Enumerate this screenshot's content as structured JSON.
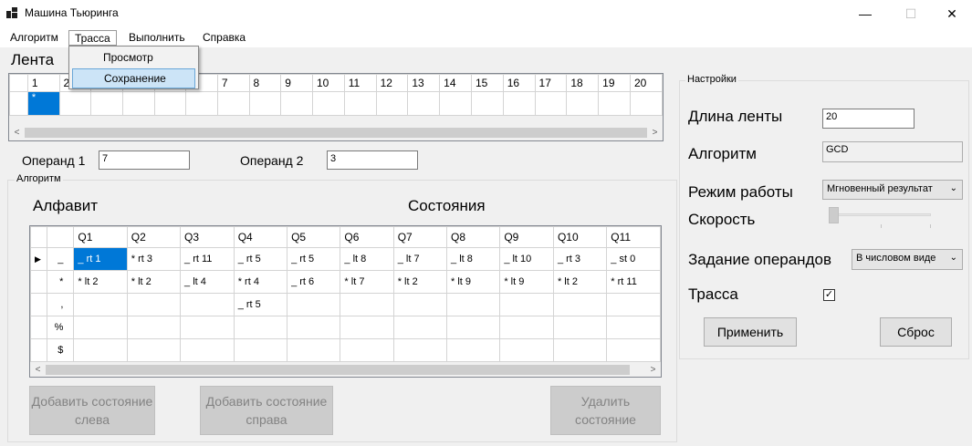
{
  "window": {
    "title": "Машина Тьюринга",
    "minimize": "—",
    "maximize": "☐",
    "close": "✕"
  },
  "menu": {
    "items": [
      "Алгоритм",
      "Трасса",
      "Выполнить",
      "Справка"
    ],
    "dropdown": [
      "Просмотр",
      "Сохранение"
    ]
  },
  "tape": {
    "label": "Лента",
    "headers": [
      "1",
      "2",
      "",
      "",
      "",
      "",
      "7",
      "8",
      "9",
      "10",
      "11",
      "12",
      "13",
      "14",
      "15",
      "16",
      "17",
      "18",
      "19",
      "20"
    ],
    "cells": [
      "*",
      "",
      "",
      "",
      "",
      "",
      "",
      "",
      "",
      "",
      "",
      "",
      "",
      "",
      "",
      "",
      "",
      "",
      "",
      ""
    ]
  },
  "operands": {
    "op1_label": "Операнд 1",
    "op1_value": "7",
    "op2_label": "Операнд 2",
    "op2_value": "3"
  },
  "algorithm": {
    "group_title": "Алгоритм",
    "alphabet_label": "Алфавит",
    "states_label": "Состояния",
    "states": [
      "Q1",
      "Q2",
      "Q3",
      "Q4",
      "Q5",
      "Q6",
      "Q7",
      "Q8",
      "Q9",
      "Q10",
      "Q11"
    ],
    "rows": [
      {
        "symbol": "_",
        "current": "▶",
        "cells": [
          "_ rt 1",
          "* rt 3",
          "_ rt 11",
          "_ rt 5",
          "_ rt 5",
          "_ lt 8",
          "_ lt 7",
          "_ lt 8",
          "_ lt 10",
          "_ rt 3",
          "_ st 0"
        ]
      },
      {
        "symbol": "*",
        "current": "",
        "cells": [
          "* lt 2",
          "* lt 2",
          "_ lt 4",
          "* rt 4",
          "_ rt 6",
          "* lt 7",
          "* lt 2",
          "* lt 9",
          "* lt 9",
          "* lt 2",
          "* rt 11"
        ]
      },
      {
        "symbol": ",",
        "current": "",
        "cells": [
          "",
          "",
          "",
          "_ rt 5",
          "",
          "",
          "",
          "",
          "",
          "",
          ""
        ]
      },
      {
        "symbol": "%",
        "current": "",
        "cells": [
          "",
          "",
          "",
          "",
          "",
          "",
          "",
          "",
          "",
          "",
          ""
        ]
      },
      {
        "symbol": "$",
        "current": "",
        "cells": [
          "",
          "",
          "",
          "",
          "",
          "",
          "",
          "",
          "",
          "",
          ""
        ]
      }
    ],
    "btn_add_left": "Добавить состояние слева",
    "btn_add_right": "Добавить состояние справа",
    "btn_delete": "Удалить состояние"
  },
  "settings": {
    "group_title": "Настройки",
    "tape_length_label": "Длина ленты",
    "tape_length_value": "20",
    "algorithm_label": "Алгоритм",
    "algorithm_value": "GCD",
    "mode_label": "Режим работы",
    "mode_value": "Мгновенный результат",
    "speed_label": "Скорость",
    "operand_mode_label": "Задание операндов",
    "operand_mode_value": "В числовом виде",
    "trace_label": "Трасса",
    "trace_checked": "✓",
    "apply": "Применить",
    "reset": "Сброс"
  }
}
